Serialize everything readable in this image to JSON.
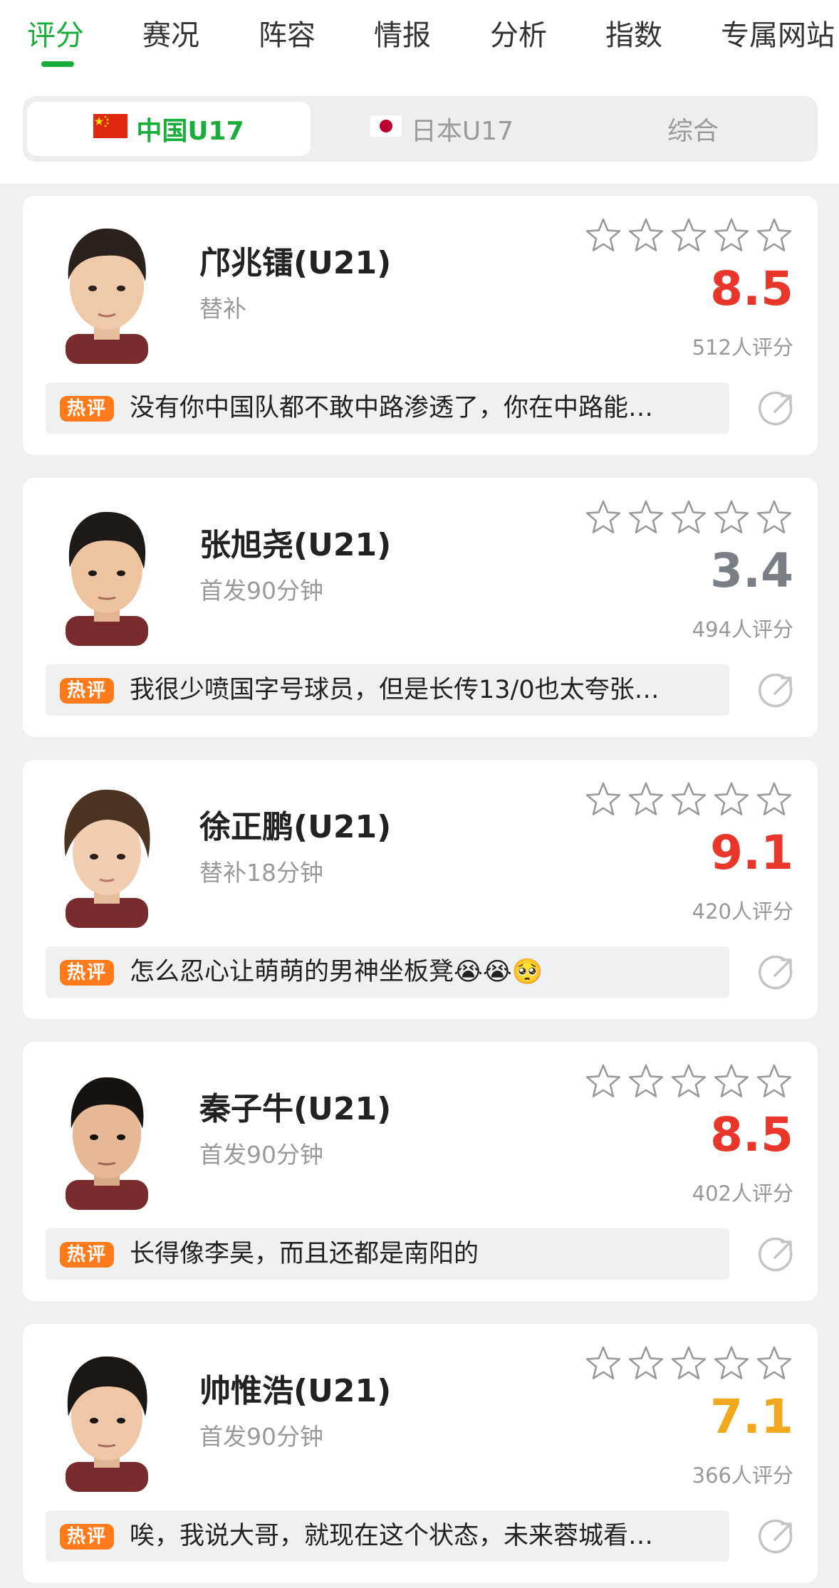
{
  "tabs": [
    "评分",
    "赛况",
    "阵容",
    "情报",
    "分析",
    "指数",
    "专属网站"
  ],
  "active_tab": "评分",
  "segment": {
    "china": "中国U17",
    "japan": "日本U17",
    "all": "综合"
  },
  "hot_label": "热评",
  "colors": {
    "green": "#1aad3c",
    "red": "#e8362a",
    "gray": "#7a7f86",
    "orange": "#f1a81c",
    "hot": "#ff7a1a"
  },
  "players": [
    {
      "name": "邝兆镭(U21)",
      "role": "替补",
      "score": "8.5",
      "score_color": "#e8362a",
      "rating_count": "512人评分",
      "comment": "没有你中国队都不敢中路渗透了，你在中路能…"
    },
    {
      "name": "张旭尧(U21)",
      "role": "首发90分钟",
      "score": "3.4",
      "score_color": "#7a7f86",
      "rating_count": "494人评分",
      "comment": "我很少喷国字号球员，但是长传13/0也太夸张…"
    },
    {
      "name": "徐正鹏(U21)",
      "role": "替补18分钟",
      "score": "9.1",
      "score_color": "#e8362a",
      "rating_count": "420人评分",
      "comment": "怎么忍心让萌萌的男神坐板凳😭😭🥺"
    },
    {
      "name": "秦子牛(U21)",
      "role": "首发90分钟",
      "score": "8.5",
      "score_color": "#e8362a",
      "rating_count": "402人评分",
      "comment": "长得像李昊，而且还都是南阳的"
    },
    {
      "name": "帅惟浩(U21)",
      "role": "首发90分钟",
      "score": "7.1",
      "score_color": "#f1a81c",
      "rating_count": "366人评分",
      "comment": "唉，我说大哥，就现在这个状态，未来蓉城看…"
    }
  ]
}
